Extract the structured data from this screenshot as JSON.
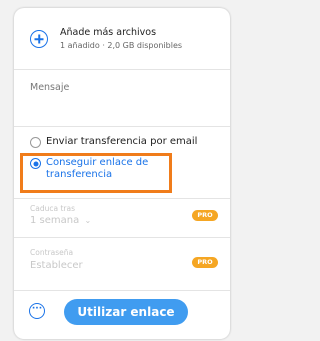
{
  "add_files": {
    "title": "Añade más archivos",
    "subtitle": "1 añadido · 2,0 GB disponibles",
    "icon": "plus-circle-icon"
  },
  "message": {
    "placeholder": "Mensaje"
  },
  "transfer_options": {
    "email_label": "Enviar transferencia por email",
    "link_label": "Conseguir enlace de transferencia",
    "selected": "link"
  },
  "settings": {
    "expires_label": "Caduca tras",
    "expires_value": "1 semana",
    "password_label": "Contraseña",
    "password_value": "Establecer",
    "pro_badge": "PRO"
  },
  "footer": {
    "more_icon": "more-options-icon",
    "primary_button": "Utilizar enlace"
  },
  "colors": {
    "accent": "#1a73e8",
    "button": "#409cf0",
    "highlight": "#f07c1a",
    "pro": "#f5a623"
  }
}
